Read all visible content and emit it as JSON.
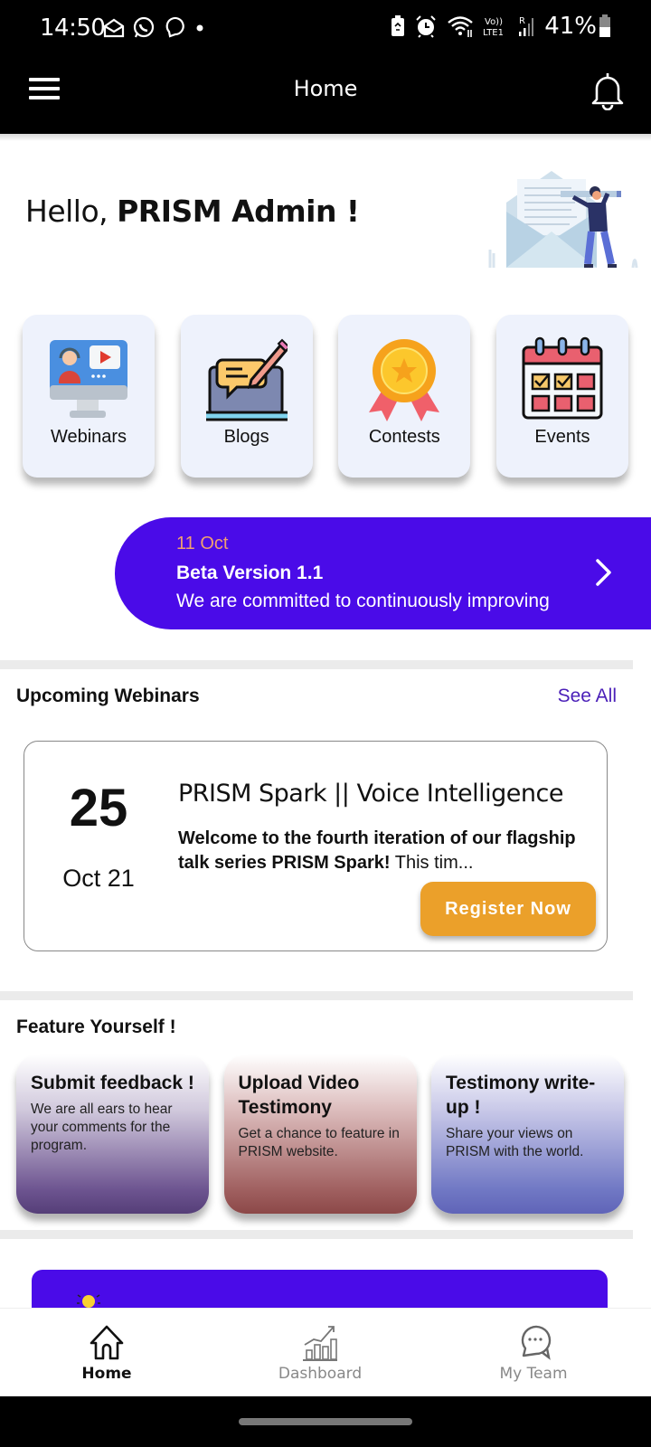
{
  "status_bar": {
    "time": "14:50",
    "notification_icons": [
      "mail-icon",
      "whatsapp-icon",
      "chat-bubble-icon",
      "dot-icon"
    ],
    "system_icons": [
      "battery-saver-icon",
      "alarm-icon",
      "wifi-icon",
      "volte-lte-icon",
      "signal-icon"
    ],
    "volte_label": "Vo)) LTE1",
    "roaming_label": "R",
    "battery_percent": "41%"
  },
  "app_bar": {
    "title": "Home",
    "left_icon": "hamburger-menu-icon",
    "right_icon": "bell-icon"
  },
  "greeting": {
    "prefix": "Hello, ",
    "name": "PRISM Admin !"
  },
  "quick_links": [
    {
      "label": "Webinars",
      "icon": "webinar-monitor-icon"
    },
    {
      "label": "Blogs",
      "icon": "blog-laptop-icon"
    },
    {
      "label": "Contests",
      "icon": "medal-icon"
    },
    {
      "label": "Events",
      "icon": "calendar-icon"
    }
  ],
  "announcement": {
    "date": "11 Oct",
    "title": "Beta Version 1.1",
    "body": "We are committed to continuously improving",
    "colors": {
      "background": "#4a0be8",
      "date": "#f0a070"
    }
  },
  "upcoming_webinars": {
    "title": "Upcoming Webinars",
    "see_all_label": "See All",
    "items": [
      {
        "day": "25",
        "month_year": "Oct 21",
        "title": "PRISM Spark || Voice Intelligence",
        "description_bold": "Welcome to the fourth iteration of our flagship talk series PRISM Spark!",
        "description_rest": " This tim...",
        "button_label": "Register Now",
        "button_color": "#eba02a"
      }
    ]
  },
  "feature_yourself": {
    "title": "Feature Yourself !",
    "cards": [
      {
        "title": "Submit feedback !",
        "description": "We are all ears to hear your comments for the program."
      },
      {
        "title": "Upload Video Testimony",
        "description": "Get a chance to feature in PRISM website."
      },
      {
        "title": "Testimony write-up !",
        "description": "Share your views on PRISM with the world."
      }
    ]
  },
  "bottom_nav": {
    "items": [
      {
        "label": "Home",
        "icon": "home-icon",
        "active": true
      },
      {
        "label": "Dashboard",
        "icon": "chart-growth-icon",
        "active": false
      },
      {
        "label": "My Team",
        "icon": "chat-bubbles-icon",
        "active": false
      }
    ]
  }
}
